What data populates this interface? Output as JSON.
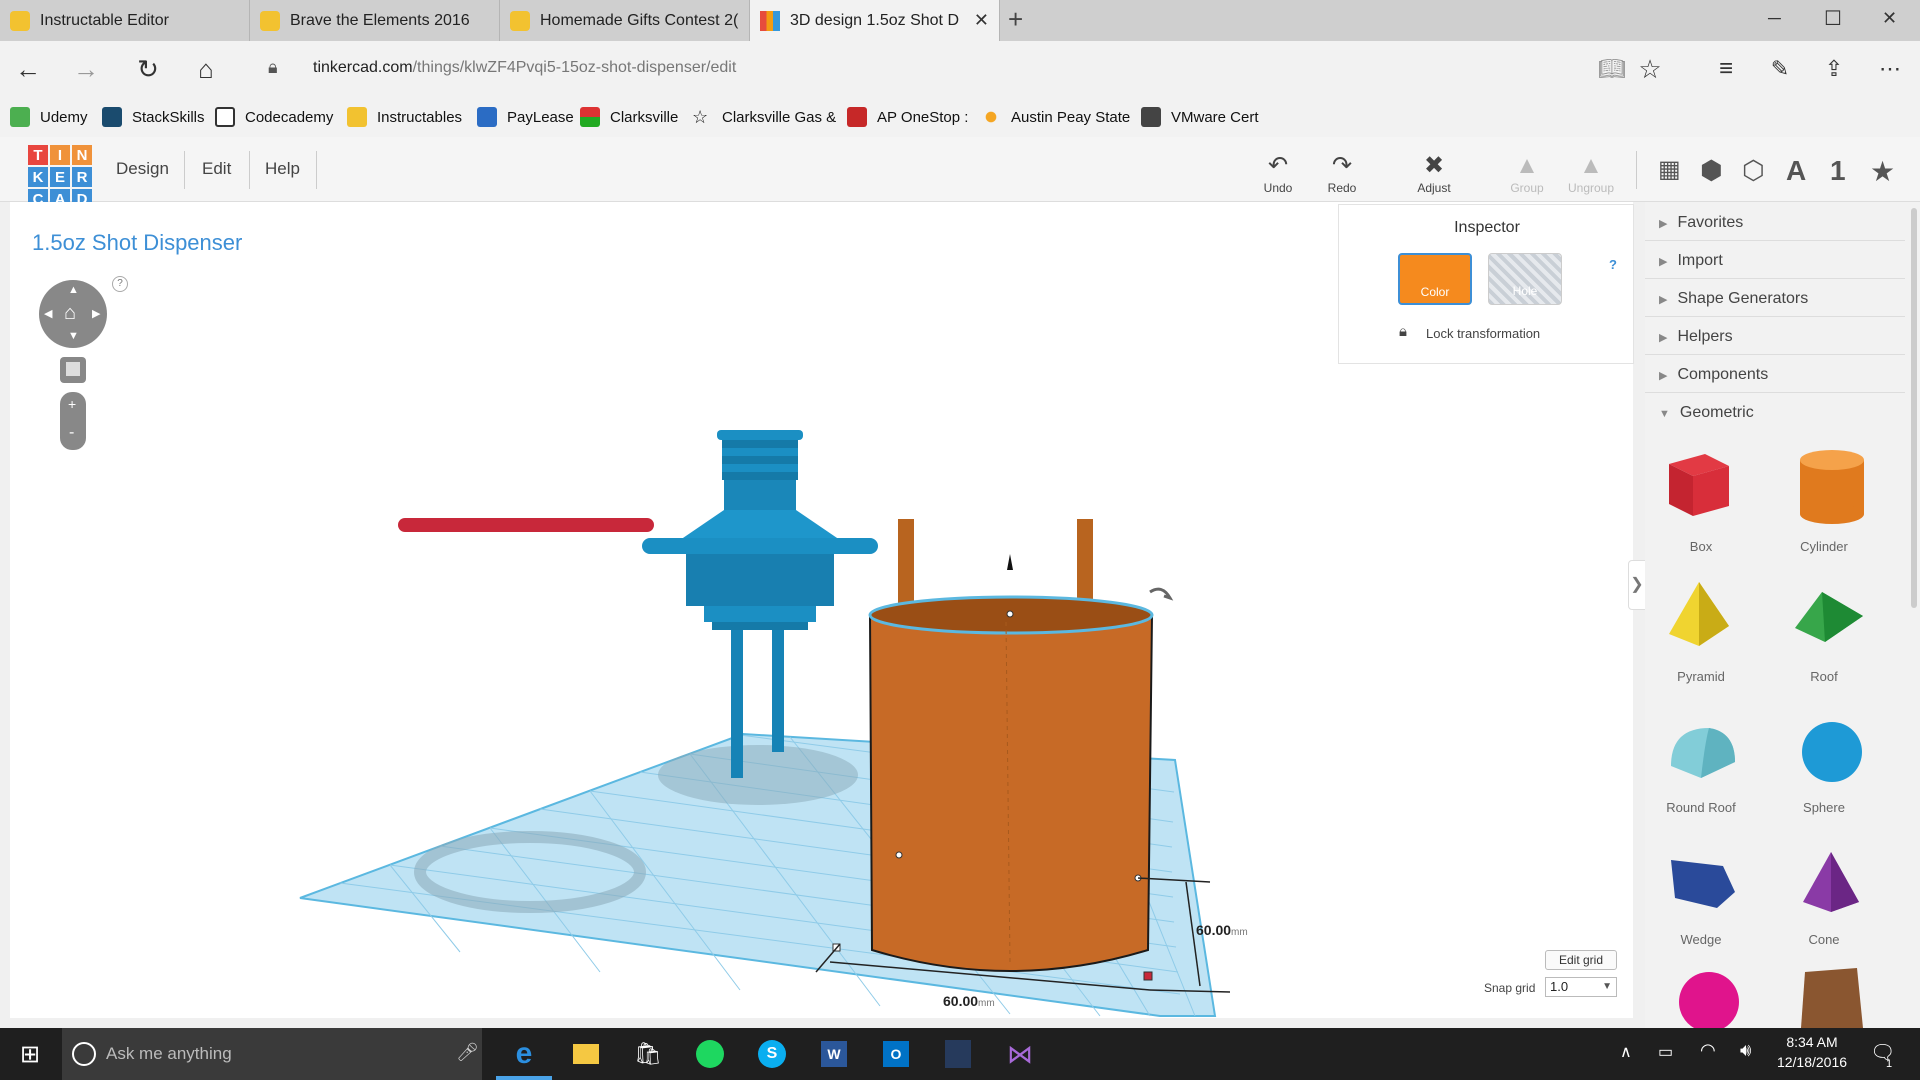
{
  "browser": {
    "tabs": [
      {
        "label": "Instructable Editor",
        "active": false
      },
      {
        "label": "Brave the Elements 2016",
        "active": false
      },
      {
        "label": "Homemade Gifts Contest 2(",
        "active": false
      },
      {
        "label": "3D design 1.5oz Shot D",
        "active": true
      }
    ],
    "new_tab": "+",
    "window_controls": {
      "minimize": "─",
      "maximize": "☐",
      "close": "✕"
    },
    "url_host": "tinkercad.com",
    "url_path": "/things/klwZF4Pvqi5-15oz-shot-dispenser/edit",
    "favorites": [
      "Udemy",
      "StackSkills",
      "Codecademy",
      "Instructables",
      "PayLease",
      "Clarksville",
      "Clarksville Gas &",
      "AP OneStop :",
      "Austin Peay State",
      "VMware Cert"
    ]
  },
  "tinkercad": {
    "logo": [
      "T",
      "I",
      "N",
      "K",
      "E",
      "R",
      "C",
      "A",
      "D"
    ],
    "menu": [
      "Design",
      "Edit",
      "Help"
    ],
    "tools": [
      {
        "label": "Undo",
        "icon": "undo-icon",
        "enabled": true
      },
      {
        "label": "Redo",
        "icon": "redo-icon",
        "enabled": true
      },
      {
        "label": "Adjust",
        "icon": "adjust-icon",
        "enabled": true
      },
      {
        "label": "Group",
        "icon": "group-icon",
        "enabled": false
      },
      {
        "label": "Ungroup",
        "icon": "ungroup-icon",
        "enabled": false
      }
    ],
    "view_icons": [
      "grid-view-icon",
      "box-view-icon",
      "wireframe-view-icon",
      "A",
      "1",
      "★"
    ],
    "design_title": "1.5oz Shot Dispenser",
    "nav_help": "?",
    "zoom_in": "+",
    "zoom_out": "-"
  },
  "inspector": {
    "title": "Inspector",
    "color_label": "Color",
    "hole_label": "Hole",
    "help": "?",
    "lock_label": "Lock transformation",
    "color_hex": "#f58a1e"
  },
  "panel": {
    "sections": [
      "Favorites",
      "Import",
      "Shape Generators",
      "Helpers",
      "Components",
      "Geometric"
    ],
    "shapes": [
      "Box",
      "Cylinder",
      "Pyramid",
      "Roof",
      "Round Roof",
      "Sphere",
      "Wedge",
      "Cone"
    ],
    "collapse": "❯"
  },
  "workplane": {
    "dim_width": "60.00",
    "dim_depth": "60.00",
    "dim_unit": "mm",
    "edit_grid": "Edit grid",
    "snap_label": "Snap grid",
    "snap_value": "1.0"
  },
  "taskbar": {
    "search_placeholder": "Ask me anything",
    "time": "8:34 AM",
    "date": "12/18/2016",
    "notifications": "1"
  },
  "colors": {
    "accent_blue": "#3d8fd6",
    "shape_orange": "#c76a26",
    "part_blue": "#1b8fc3",
    "handle_red": "#c8283a"
  }
}
